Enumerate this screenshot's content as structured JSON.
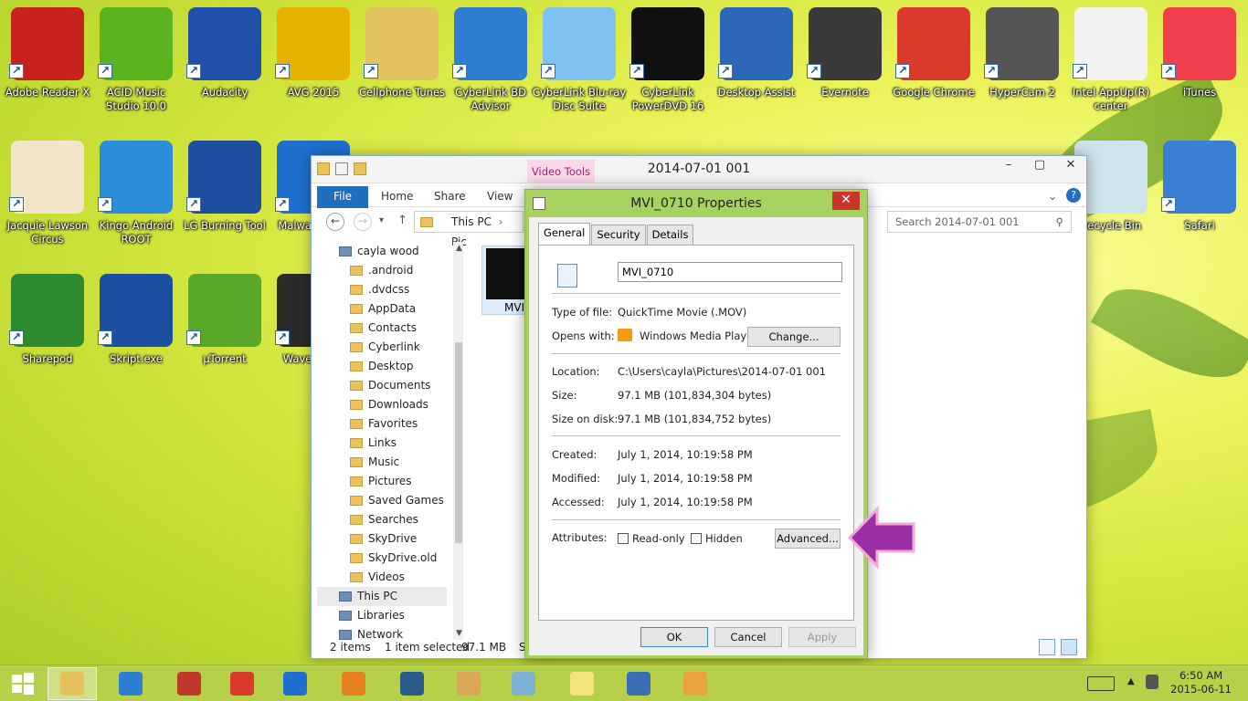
{
  "desktop": {
    "icons": [
      {
        "label": "Adobe Reader X",
        "icon": "adobe-reader-icon",
        "color": "#c8201b"
      },
      {
        "label": "ACID Music Studio 10.0",
        "icon": "acid-music-icon",
        "color": "#5ab31f"
      },
      {
        "label": "Audacity",
        "icon": "audacity-icon",
        "color": "#1f4fa8"
      },
      {
        "label": "AVG 2015",
        "icon": "avg-icon",
        "color": "#e7b100"
      },
      {
        "label": "Cellphone Tunes",
        "icon": "folder-icon",
        "color": "#e3c260"
      },
      {
        "label": "CyberLink BD Advisor",
        "icon": "bd-advisor-icon",
        "color": "#2e7fd1"
      },
      {
        "label": "CyberLink Blu-ray Disc Suite",
        "icon": "bluray-suite-icon",
        "color": "#7fc1f0"
      },
      {
        "label": "CyberLink PowerDVD 16",
        "icon": "powerdvd-icon",
        "color": "#111111"
      },
      {
        "label": "Desktop Assist",
        "icon": "desktop-assist-icon",
        "color": "#2b66b8"
      },
      {
        "label": "Evernote",
        "icon": "evernote-icon",
        "color": "#3a3a3a"
      },
      {
        "label": "Google Chrome",
        "icon": "chrome-icon",
        "color": "#d93a2b"
      },
      {
        "label": "HyperCam 2",
        "icon": "hypercam-icon",
        "color": "#555555"
      },
      {
        "label": "Intel AppUp(R) center",
        "icon": "intel-appup-icon",
        "color": "#f2f2f2"
      },
      {
        "label": "iTunes",
        "icon": "itunes-icon",
        "color": "#f0404f"
      },
      {
        "label": "Jacquie Lawson Circus",
        "icon": "circus-icon",
        "color": "#f2e6c8"
      },
      {
        "label": "Kingo Android ROOT",
        "icon": "kingo-root-icon",
        "color": "#2b8ed8"
      },
      {
        "label": "LG Burning Tool",
        "icon": "lg-burning-icon",
        "color": "#1d4ea0"
      },
      {
        "label": "Malwa Anti-M",
        "icon": "malwarebytes-icon",
        "color": "#1f6fd0"
      },
      {
        "label": "Recycle Bin",
        "icon": "recycle-bin-icon",
        "color": "#cfe3ea"
      },
      {
        "label": "Safari",
        "icon": "safari-icon",
        "color": "#3b7fd4"
      },
      {
        "label": "Sharepod",
        "icon": "sharepod-icon",
        "color": "#2c8a2c"
      },
      {
        "label": "Skript.exe",
        "icon": "skript-icon",
        "color": "#1b4fa0"
      },
      {
        "label": "µTorrent",
        "icon": "utorrent-icon",
        "color": "#5aa82a"
      },
      {
        "label": "WavePa Edi",
        "icon": "wavepad-icon",
        "color": "#2a2a2a"
      }
    ]
  },
  "explorer": {
    "title": "2014-07-01 001",
    "contextual_tab": "Video Tools",
    "ribbon_tabs": [
      "File",
      "Home",
      "Share",
      "View"
    ],
    "breadcrumb": [
      "This PC",
      "Pic"
    ],
    "search_placeholder": "Search 2014-07-01 001",
    "nav_items": [
      {
        "label": "cayla wood",
        "level": 0,
        "icon": "user-folder-icon"
      },
      {
        "label": ".android",
        "level": 1,
        "icon": "folder-icon"
      },
      {
        "label": ".dvdcss",
        "level": 1,
        "icon": "folder-icon"
      },
      {
        "label": "AppData",
        "level": 1,
        "icon": "folder-icon"
      },
      {
        "label": "Contacts",
        "level": 1,
        "icon": "folder-icon"
      },
      {
        "label": "Cyberlink",
        "level": 1,
        "icon": "folder-icon"
      },
      {
        "label": "Desktop",
        "level": 1,
        "icon": "folder-icon"
      },
      {
        "label": "Documents",
        "level": 1,
        "icon": "folder-icon"
      },
      {
        "label": "Downloads",
        "level": 1,
        "icon": "folder-icon"
      },
      {
        "label": "Favorites",
        "level": 1,
        "icon": "folder-icon"
      },
      {
        "label": "Links",
        "level": 1,
        "icon": "folder-icon"
      },
      {
        "label": "Music",
        "level": 1,
        "icon": "folder-icon"
      },
      {
        "label": "Pictures",
        "level": 1,
        "icon": "folder-icon"
      },
      {
        "label": "Saved Games",
        "level": 1,
        "icon": "folder-icon"
      },
      {
        "label": "Searches",
        "level": 1,
        "icon": "folder-icon"
      },
      {
        "label": "SkyDrive",
        "level": 1,
        "icon": "folder-icon"
      },
      {
        "label": "SkyDrive.old",
        "level": 1,
        "icon": "folder-icon"
      },
      {
        "label": "Videos",
        "level": 1,
        "icon": "folder-icon"
      },
      {
        "label": "This PC",
        "level": 0,
        "icon": "computer-icon"
      },
      {
        "label": "Libraries",
        "level": 0,
        "icon": "libraries-icon"
      },
      {
        "label": "Network",
        "level": 0,
        "icon": "network-icon"
      }
    ],
    "file_name": "MVI_",
    "status": {
      "items": "2 items",
      "selected": "1 item selected",
      "size": "97.1 MB",
      "extra": "S"
    }
  },
  "dialog": {
    "title": "MVI_0710 Properties",
    "tabs": [
      "General",
      "Security",
      "Details"
    ],
    "name_value": "MVI_0710",
    "type_label": "Type of file:",
    "type_value": "QuickTime Movie (.MOV)",
    "opens_label": "Opens with:",
    "opens_value": "Windows Media Player",
    "change_btn": "Change...",
    "location_label": "Location:",
    "location_value": "C:\\Users\\cayla\\Pictures\\2014-07-01 001",
    "size_label": "Size:",
    "size_value": "97.1 MB (101,834,304 bytes)",
    "disk_label": "Size on disk:",
    "disk_value": "97.1 MB (101,834,752 bytes)",
    "created_label": "Created:",
    "created_value": "July 1, 2014, 10:19:58 PM",
    "modified_label": "Modified:",
    "modified_value": "July 1, 2014, 10:19:58 PM",
    "accessed_label": "Accessed:",
    "accessed_value": "July 1, 2014, 10:19:58 PM",
    "attributes_label": "Attributes:",
    "readonly": "Read-only",
    "hidden": "Hidden",
    "advanced_btn": "Advanced...",
    "ok": "OK",
    "cancel": "Cancel",
    "apply": "Apply"
  },
  "taskbar": {
    "apps": [
      {
        "icon": "file-explorer-icon",
        "color": "#e6c25c"
      },
      {
        "icon": "wondershare-icon",
        "color": "#2d7fd1"
      },
      {
        "icon": "winrar-icon",
        "color": "#c0392b"
      },
      {
        "icon": "chrome-icon",
        "color": "#d93a2b"
      },
      {
        "icon": "malwarebytes-icon",
        "color": "#1f6fd0"
      },
      {
        "icon": "powerdvd-icon",
        "color": "#e67e22"
      },
      {
        "icon": "film-icon",
        "color": "#2a5b8a"
      },
      {
        "icon": "circus-icon",
        "color": "#d9a65a"
      },
      {
        "icon": "notes-icon",
        "color": "#7fb3d5"
      },
      {
        "icon": "sticky-notes-icon",
        "color": "#f4e27a"
      },
      {
        "icon": "wordpad-icon",
        "color": "#3a6fb5"
      },
      {
        "icon": "paint-icon",
        "color": "#e8a33d"
      }
    ],
    "time": "6:50 AM",
    "date": "2015-06-11"
  },
  "colors": {
    "accent": "#a7d25f",
    "file_tab": "#1f6ebf",
    "close": "#c8352a",
    "arrow": "#9b2fa6"
  }
}
